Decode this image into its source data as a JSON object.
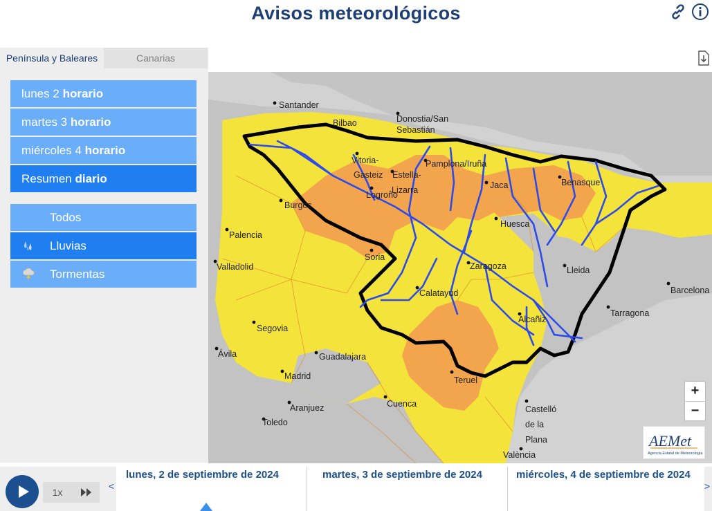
{
  "title": "Avisos meteorológicos",
  "header_icons": [
    "link-icon",
    "info-icon",
    "download-icon"
  ],
  "region_tabs": [
    {
      "label": "Península y Baleares",
      "active": true
    },
    {
      "label": "Canarias",
      "active": false
    }
  ],
  "day_buttons": [
    {
      "pre": "lunes 2",
      "bold": "horario"
    },
    {
      "pre": "martes 3",
      "bold": "horario"
    },
    {
      "pre": "miércoles 4",
      "bold": "horario"
    },
    {
      "pre": "Resumen",
      "bold": "diario",
      "selected": true
    }
  ],
  "type_buttons": [
    {
      "label": "Todos",
      "icon": "none"
    },
    {
      "label": "Lluvias",
      "icon": "rain-icon",
      "selected": true
    },
    {
      "label": "Tormentas",
      "icon": "storm-icon"
    }
  ],
  "map": {
    "cities": [
      {
        "name": "Santander"
      },
      {
        "name": "Bilbao"
      },
      {
        "name": "Donostia/San"
      },
      {
        "name": "Sebastián"
      },
      {
        "name": "Vitoria-"
      },
      {
        "name": "Gasteiz"
      },
      {
        "name": "Estella-"
      },
      {
        "name": "Lizarra"
      },
      {
        "name": "Pamplona/Iruña"
      },
      {
        "name": "Logroño"
      },
      {
        "name": "Jaca"
      },
      {
        "name": "Benasque"
      },
      {
        "name": "Burgos"
      },
      {
        "name": "Huesca"
      },
      {
        "name": "Palencia"
      },
      {
        "name": "Soria"
      },
      {
        "name": "Zaragoza"
      },
      {
        "name": "Valladolid"
      },
      {
        "name": "Lleida"
      },
      {
        "name": "Barcelona"
      },
      {
        "name": "Calatayud"
      },
      {
        "name": "Tarragona"
      },
      {
        "name": "Alcañiz"
      },
      {
        "name": "Segovia"
      },
      {
        "name": "Ávila"
      },
      {
        "name": "Guadalajara"
      },
      {
        "name": "Madrid"
      },
      {
        "name": "Teruel"
      },
      {
        "name": "Aranjuez"
      },
      {
        "name": "Cuenca"
      },
      {
        "name": "Castelló"
      },
      {
        "name": "de la"
      },
      {
        "name": "Plana"
      },
      {
        "name": "Toledo"
      },
      {
        "name": "València"
      }
    ],
    "warning_colors": {
      "yellow": "#f4e33a",
      "orange": "#f2a54d",
      "none": "#c7c7c7",
      "sea": "#d7d7d7"
    },
    "basin_outline_color": "#000000",
    "river_color": "#2d4be8",
    "zoom_in": "+",
    "zoom_out": "−",
    "logo_text": "AEMet",
    "logo_subtext": "Agencia Estatal de Meteorología"
  },
  "timeline": {
    "speed": "1x",
    "prev": "<",
    "next": ">",
    "days": [
      {
        "label": "lunes, 2 de septiembre de 2024"
      },
      {
        "label": "martes, 3 de septiembre de 2024"
      },
      {
        "label": "miércoles, 4 de septiembre de 2024"
      }
    ]
  }
}
